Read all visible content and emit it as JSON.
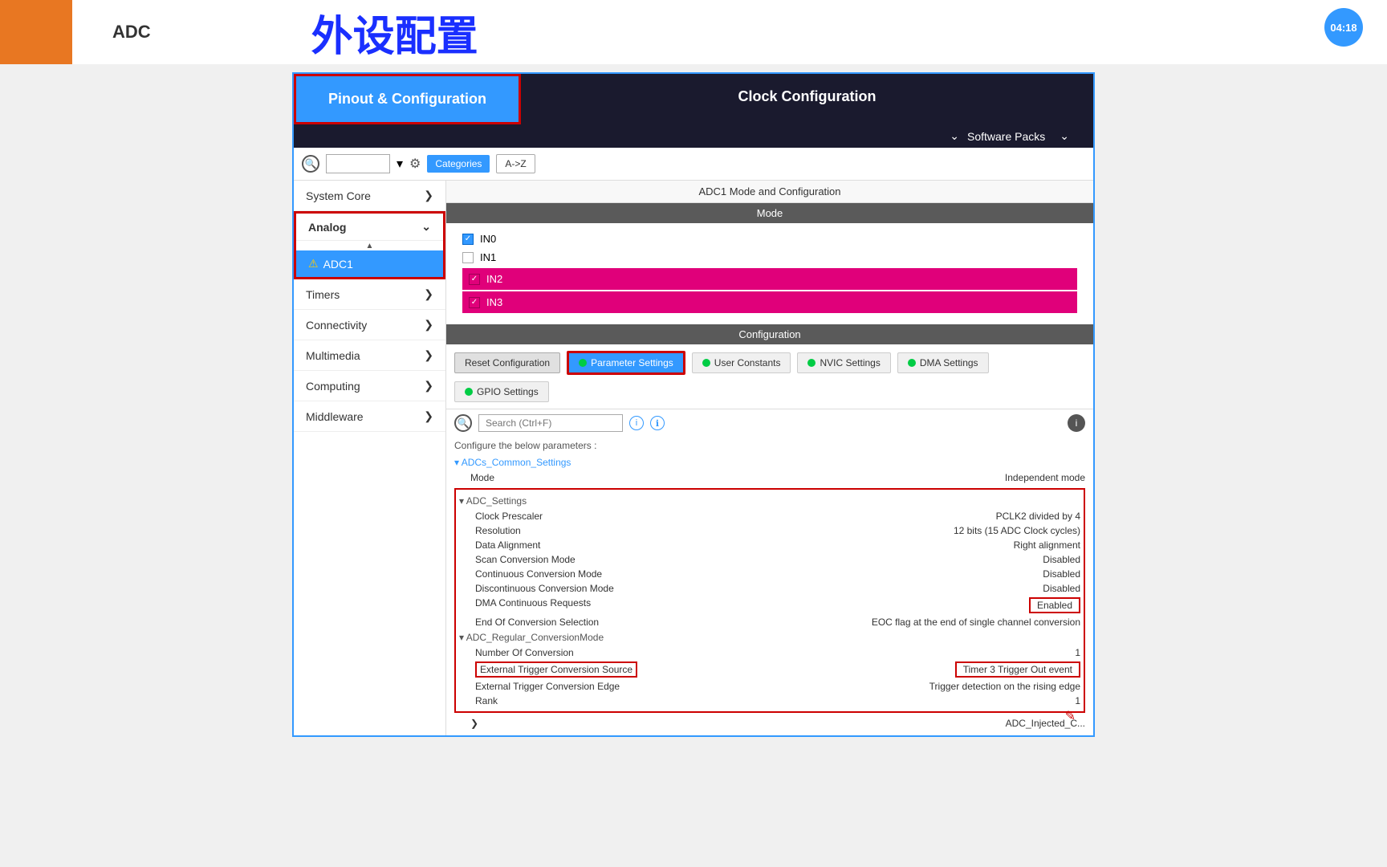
{
  "topbar": {
    "title": "ADC",
    "main_title": "外设配置",
    "time": "04:18"
  },
  "header": {
    "pinout_tab": "Pinout & Configuration",
    "clock_tab": "Clock Configuration",
    "software_packs": "Software Packs"
  },
  "filter": {
    "categories_label": "Categories",
    "az_label": "A->Z"
  },
  "sidebar": {
    "system_core": "System Core",
    "analog": "Analog",
    "adc1": "ADC1",
    "timers": "Timers",
    "connectivity": "Connectivity",
    "multimedia": "Multimedia",
    "computing": "Computing",
    "middleware": "Middleware"
  },
  "main": {
    "adc1_mode_config": "ADC1 Mode and Configuration",
    "mode_label": "Mode",
    "configuration_label": "Configuration",
    "in0": "IN0",
    "in1": "IN1",
    "in2": "IN2",
    "in3": "IN3",
    "reset_config": "Reset Configuration",
    "param_settings": "Parameter Settings",
    "user_constants": "User Constants",
    "nvic_settings": "NVIC Settings",
    "dma_settings": "DMA Settings",
    "gpio_settings": "GPIO Settings",
    "configure_params": "Configure the below parameters :",
    "search_placeholder": "Search (Ctrl+F)"
  },
  "settings": {
    "adcs_common": "ADCs_Common_Settings",
    "mode_label": "Mode",
    "mode_value": "Independent mode",
    "adc_settings": "ADC_Settings",
    "clock_prescaler_label": "Clock Prescaler",
    "clock_prescaler_value": "PCLK2 divided by 4",
    "resolution_label": "Resolution",
    "resolution_value": "12 bits (15 ADC Clock cycles)",
    "data_alignment_label": "Data Alignment",
    "data_alignment_value": "Right alignment",
    "scan_conversion_label": "Scan Conversion Mode",
    "scan_conversion_value": "Disabled",
    "continuous_label": "Continuous Conversion Mode",
    "continuous_value": "Disabled",
    "discontinuous_label": "Discontinuous Conversion Mode",
    "discontinuous_value": "Disabled",
    "dma_requests_label": "DMA Continuous Requests",
    "dma_requests_value": "Enabled",
    "eoc_label": "End Of Conversion Selection",
    "eoc_value": "EOC flag at the end of single channel conversion",
    "regular_mode": "ADC_Regular_ConversionMode",
    "num_conversion_label": "Number Of Conversion",
    "num_conversion_value": "1",
    "ext_trigger_source_label": "External Trigger Conversion Source",
    "ext_trigger_source_value": "Timer 3 Trigger Out event",
    "ext_trigger_edge_label": "External Trigger Conversion Edge",
    "ext_trigger_edge_value": "Trigger detection on the rising edge",
    "rank_label": "Rank",
    "rank_value": "1"
  }
}
